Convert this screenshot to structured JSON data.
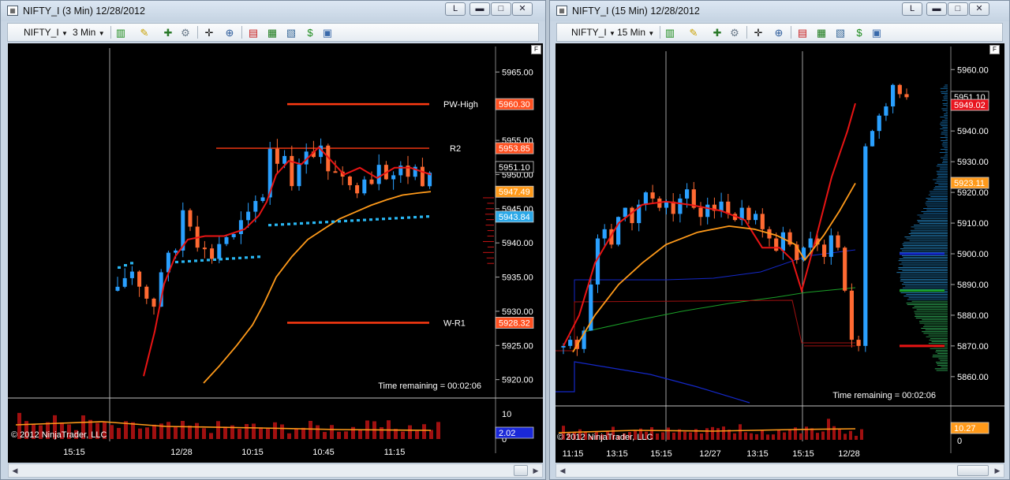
{
  "windows": [
    {
      "title": "NIFTY_I (3 Min)   12/28/2012",
      "toolbar": {
        "instrument": "NIFTY_I",
        "period": "3 Min"
      },
      "price_axis": {
        "ticks": [
          "5965.00",
          "5960.00",
          "5955.00",
          "5950.00",
          "5945.00",
          "5940.00",
          "5935.00",
          "5930.00",
          "5925.00",
          "5920.00"
        ],
        "tick_values": [
          5965,
          5960,
          5955,
          5950,
          5945,
          5940,
          5935,
          5930,
          5925,
          5920
        ],
        "min": 5918.0,
        "max": 5968.5
      },
      "levels": [
        {
          "name": "PW-High",
          "value": 5960.3,
          "tag": "5960.30",
          "color": "#ff3a12"
        },
        {
          "name": "R2",
          "value": 5953.85,
          "tag": "5953.85",
          "color": "#ff3a12"
        },
        {
          "name": "W-R1",
          "value": 5928.32,
          "tag": "5928.32",
          "color": "#ff3a12"
        }
      ],
      "price_tags": [
        {
          "value": 5951.1,
          "label": "5951.10",
          "bg": "#000000",
          "fg": "#ffffff"
        },
        {
          "value": 5947.49,
          "label": "5947.49",
          "bg": "#ff9a1a",
          "fg": "#000000"
        },
        {
          "value": 5943.84,
          "label": "5943.84",
          "bg": "#2aa8e8",
          "fg": "#000000"
        }
      ],
      "time_remaining": "Time remaining = 00:02:06",
      "copyright": "© 2012 NinjaTrader, LLC",
      "volume_axis": {
        "ticks": [
          "10",
          "0"
        ],
        "tag": "2.02"
      },
      "time_axis": [
        "15:15",
        "12/28",
        "10:15",
        "10:45",
        "11:15"
      ]
    },
    {
      "title": "NIFTY_I (15 Min)   12/28/2012",
      "toolbar": {
        "instrument": "NIFTY_I",
        "period": "15 Min"
      },
      "price_axis": {
        "ticks": [
          "5960.00",
          "5950.00",
          "5940.00",
          "5930.00",
          "5920.00",
          "5910.00",
          "5900.00",
          "5890.00",
          "5880.00",
          "5870.00",
          "5860.00"
        ],
        "tick_values": [
          5960,
          5950,
          5940,
          5930,
          5920,
          5910,
          5900,
          5890,
          5880,
          5870,
          5860
        ],
        "min": 5852.0,
        "max": 5967.0
      },
      "price_tags": [
        {
          "value": 5951.1,
          "label": "5951.10",
          "bg": "#000000",
          "fg": "#ffffff"
        },
        {
          "value": 5949.02,
          "label": "5949.02",
          "bg": "#e8141e",
          "fg": "#ffffff"
        },
        {
          "value": 5923.11,
          "label": "5923.11",
          "bg": "#ff9a1a",
          "fg": "#000000"
        }
      ],
      "time_remaining": "Time remaining = 00:02:06",
      "copyright": "© 2012 NinjaTrader, LLC",
      "volume_axis": {
        "ticks": [
          "0"
        ],
        "tag": "10.27"
      },
      "time_axis": [
        "11:15",
        "13:15",
        "15:15",
        "12/27",
        "13:15",
        "15:15",
        "12/28"
      ]
    }
  ],
  "colors": {
    "up_candle": "#2aa0ff",
    "down_candle": "#ff6a32",
    "fast_ma": "#e81414",
    "slow_ma": "#ff9a1a",
    "pivot_dots": "#29b6f2",
    "vwap_blue": "#1428c8",
    "vwap_green": "#1aa028"
  },
  "icons": [
    "bar-style-icon",
    "pencil-icon",
    "add-indicator-icon",
    "strategy-icon",
    "crosshair-icon",
    "zoom-icon",
    "chart-trader-icon",
    "data-series-icon",
    "properties-icon",
    "dollar-icon",
    "template-icon"
  ]
}
